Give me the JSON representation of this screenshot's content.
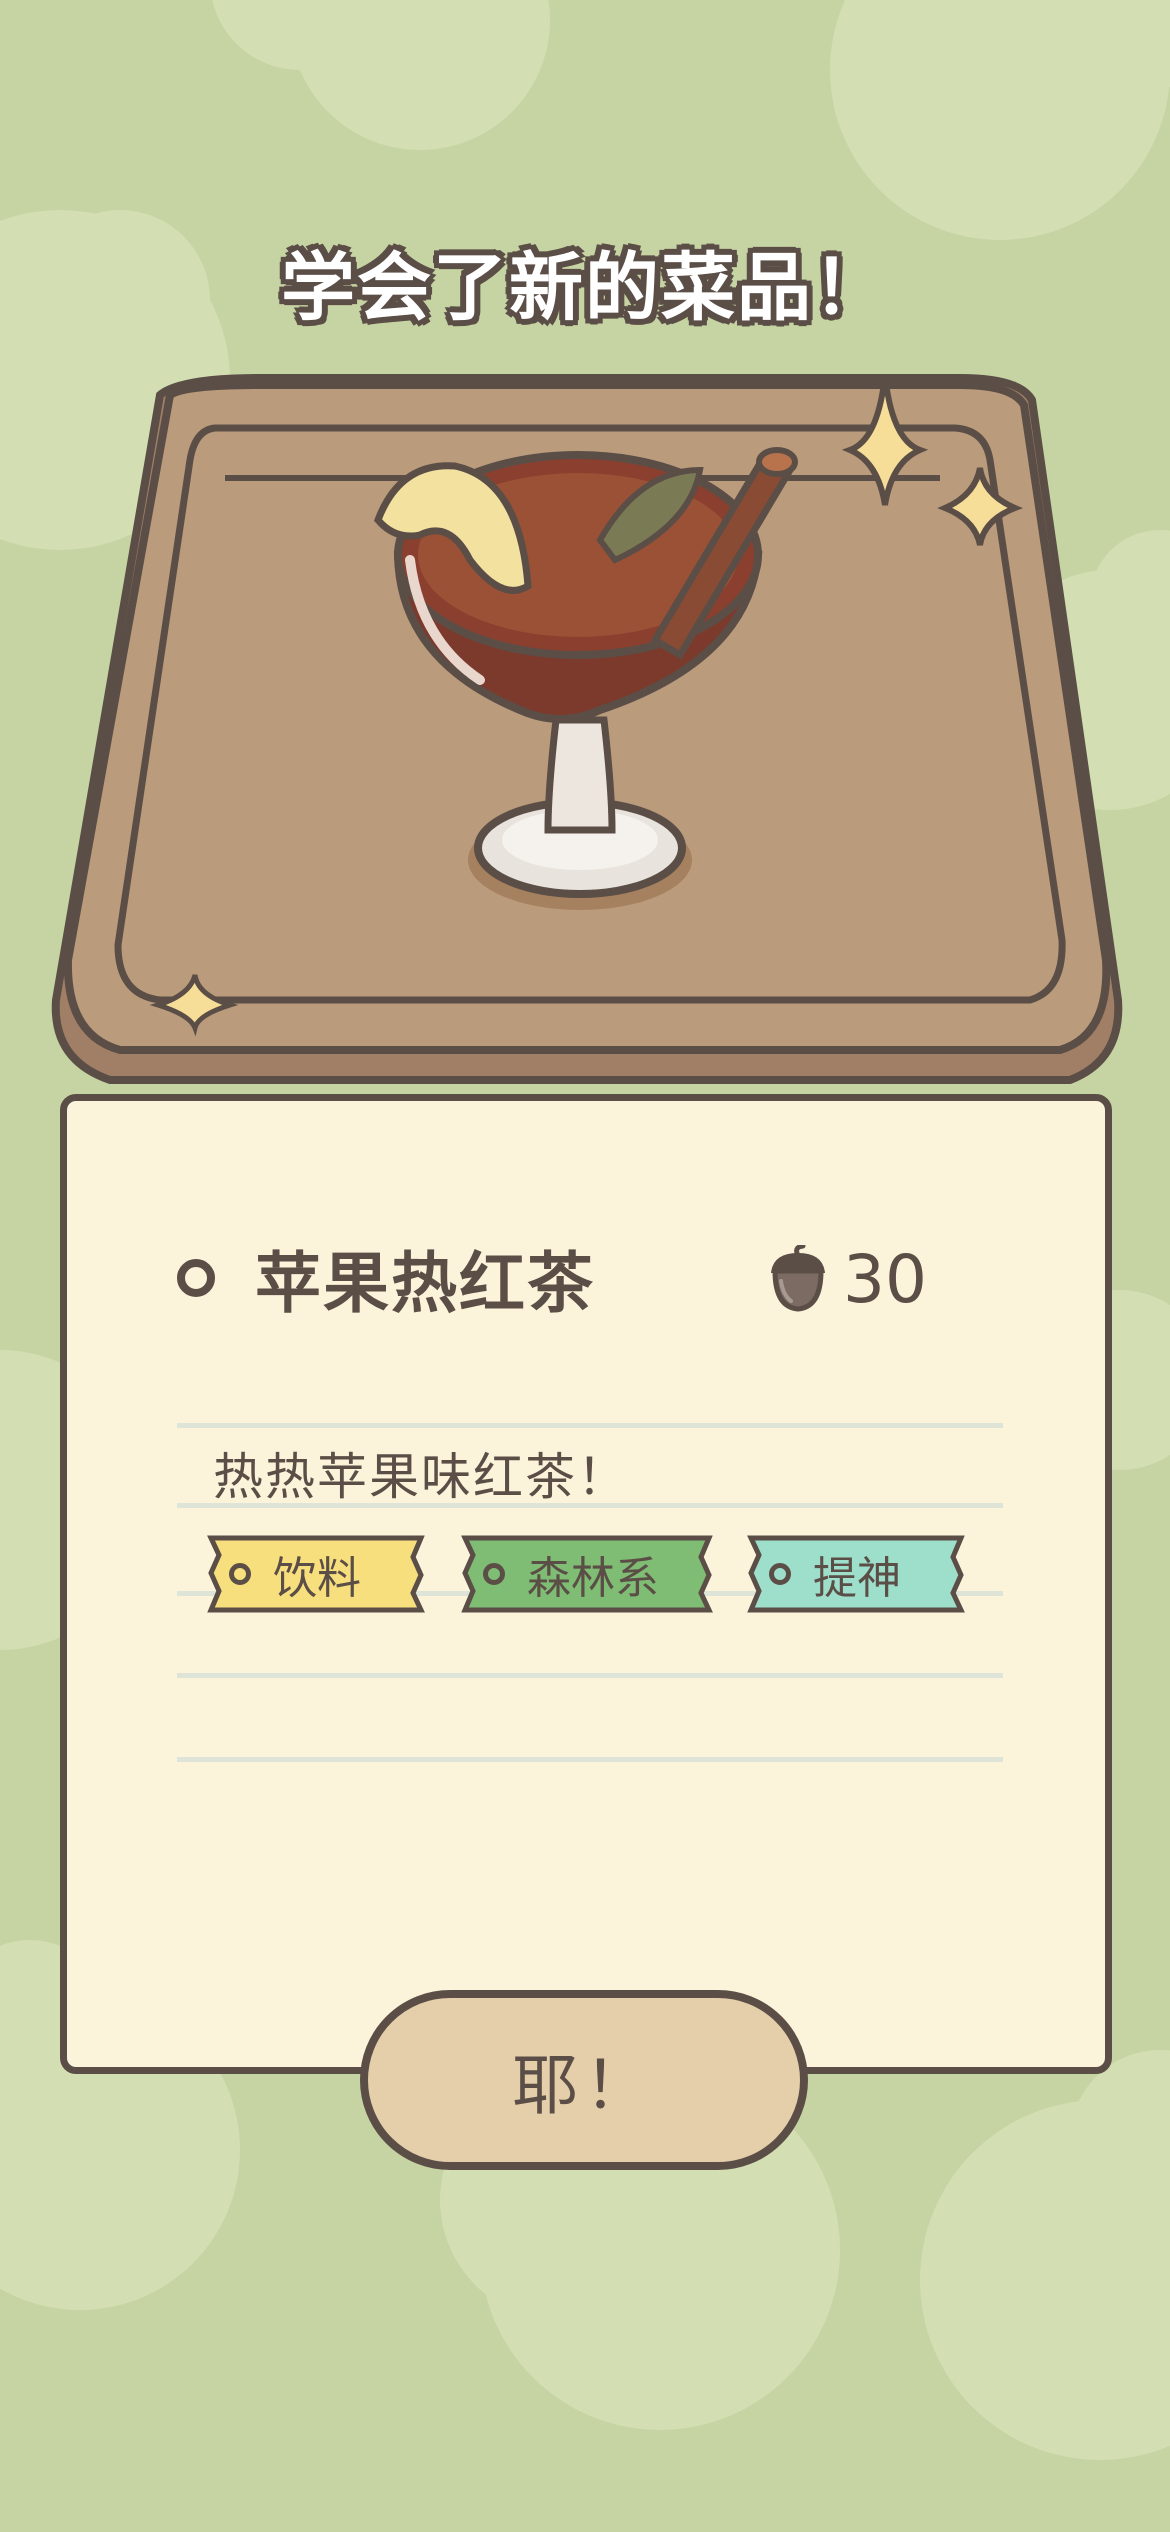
{
  "headline": "学会了新的菜品！",
  "dish": {
    "name": "苹果热红茶",
    "price": "30",
    "price_icon": "acorn-icon",
    "description": "热热苹果味红茶！",
    "tags": [
      {
        "label": "饮料",
        "color": "#f7df7e"
      },
      {
        "label": "森林系",
        "color": "#7fbc74"
      },
      {
        "label": "提神",
        "color": "#9edfcb"
      }
    ]
  },
  "confirm_button": {
    "label": "耶！"
  },
  "colors": {
    "background": "#c6d3a3",
    "card": "#fbf4da",
    "outline": "#5b4e47",
    "tray": "#ba9b7c",
    "button": "#e5cfaa"
  }
}
